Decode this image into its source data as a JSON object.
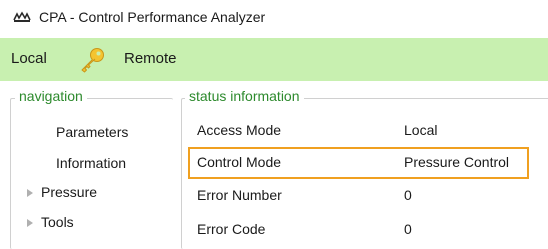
{
  "window": {
    "title": "CPA - Control Performance Analyzer",
    "icon": "app-logo-icon"
  },
  "modebar": {
    "local_label": "Local",
    "key_icon": "key-icon",
    "remote_label": "Remote",
    "background": "#c8f0b0"
  },
  "navigation": {
    "legend": "navigation",
    "items": [
      {
        "label": "Parameters",
        "expandable": false
      },
      {
        "label": "Information",
        "expandable": false
      },
      {
        "label": "Pressure",
        "expandable": true
      },
      {
        "label": "Tools",
        "expandable": true
      }
    ]
  },
  "status": {
    "legend": "status information",
    "rows": [
      {
        "label": "Access Mode",
        "value": "Local"
      },
      {
        "label": "Control Mode",
        "value": "Pressure Control",
        "highlighted": true
      },
      {
        "label": "Error Number",
        "value": "0"
      },
      {
        "label": "Error Code",
        "value": "0"
      }
    ],
    "highlight_color": "#f0a020",
    "legend_color": "#2d8a2d"
  }
}
